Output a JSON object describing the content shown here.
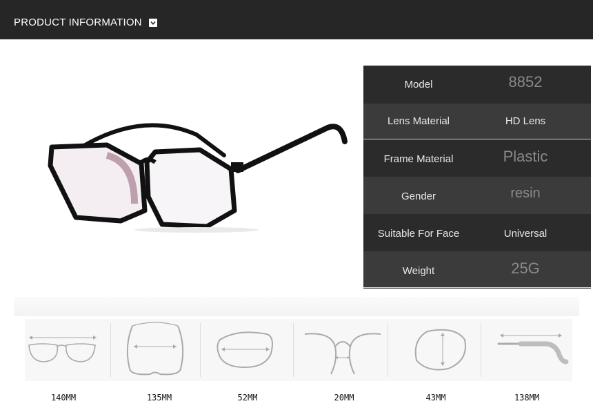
{
  "header": {
    "title": "PRODUCT INFORMATION",
    "toggle_icon": "chevron-down-icon",
    "background": "#262626"
  },
  "product_image": {
    "icon": "eyeglasses-photo"
  },
  "specs": [
    {
      "label": "Model",
      "value": "8852"
    },
    {
      "label": "Lens Material",
      "value": "HD Lens"
    },
    {
      "label": "Frame Material",
      "value": "Plastic"
    },
    {
      "label": "Gender",
      "value": "resin"
    },
    {
      "label": "Suitable For Face",
      "value": "Universal"
    },
    {
      "label": "Weight",
      "value": "25G"
    }
  ],
  "measurements": [
    {
      "icon": "frame-width-icon",
      "label": "140MM"
    },
    {
      "icon": "temple-spread-icon",
      "label": "135MM"
    },
    {
      "icon": "lens-width-icon",
      "label": "52MM"
    },
    {
      "icon": "bridge-width-icon",
      "label": "20MM"
    },
    {
      "icon": "lens-height-icon",
      "label": "43MM"
    },
    {
      "icon": "temple-length-icon",
      "label": "138MM"
    }
  ]
}
